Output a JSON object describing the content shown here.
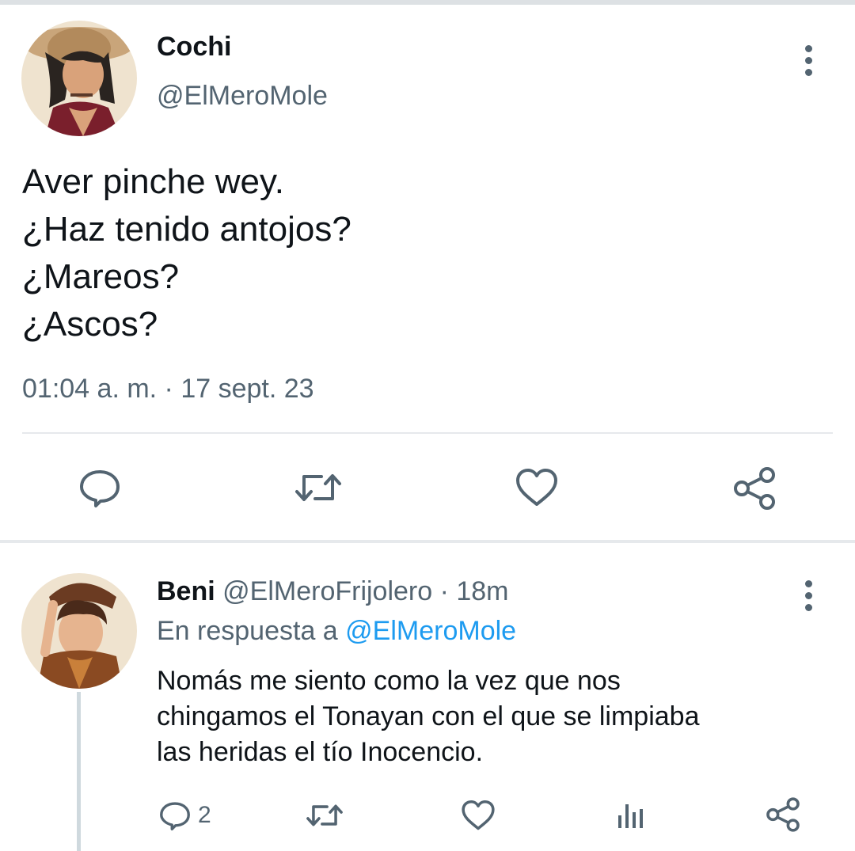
{
  "main_tweet": {
    "display_name": "Cochi",
    "handle": "@ElMeroMole",
    "text_lines": [
      "Aver pinche wey.",
      "¿Haz tenido antojos?",
      "¿Mareos?",
      "¿Ascos?"
    ],
    "timestamp": "01:04 a. m. · 17 sept. 23",
    "actions": [
      "reply-icon",
      "retweet-icon",
      "like-icon",
      "share-icon"
    ]
  },
  "reply": {
    "display_name": "Beni",
    "handle_time": "@ElMeroFrijolero · 18m",
    "reply_prefix": "En respuesta a",
    "reply_to": "@ElMeroMole",
    "text_lines": [
      "Nomás me siento como la vez que nos",
      "chingamos el Tonayan con el que se limpiaba",
      "las heridas el tío Inocencio."
    ],
    "reply_count": "2",
    "actions": [
      "reply-icon",
      "retweet-icon",
      "like-icon",
      "analytics-icon",
      "share-icon"
    ]
  },
  "colors": {
    "text": "#0f1419",
    "muted": "#536471",
    "link": "#1d9bf0",
    "divider": "#e6e9ec"
  }
}
